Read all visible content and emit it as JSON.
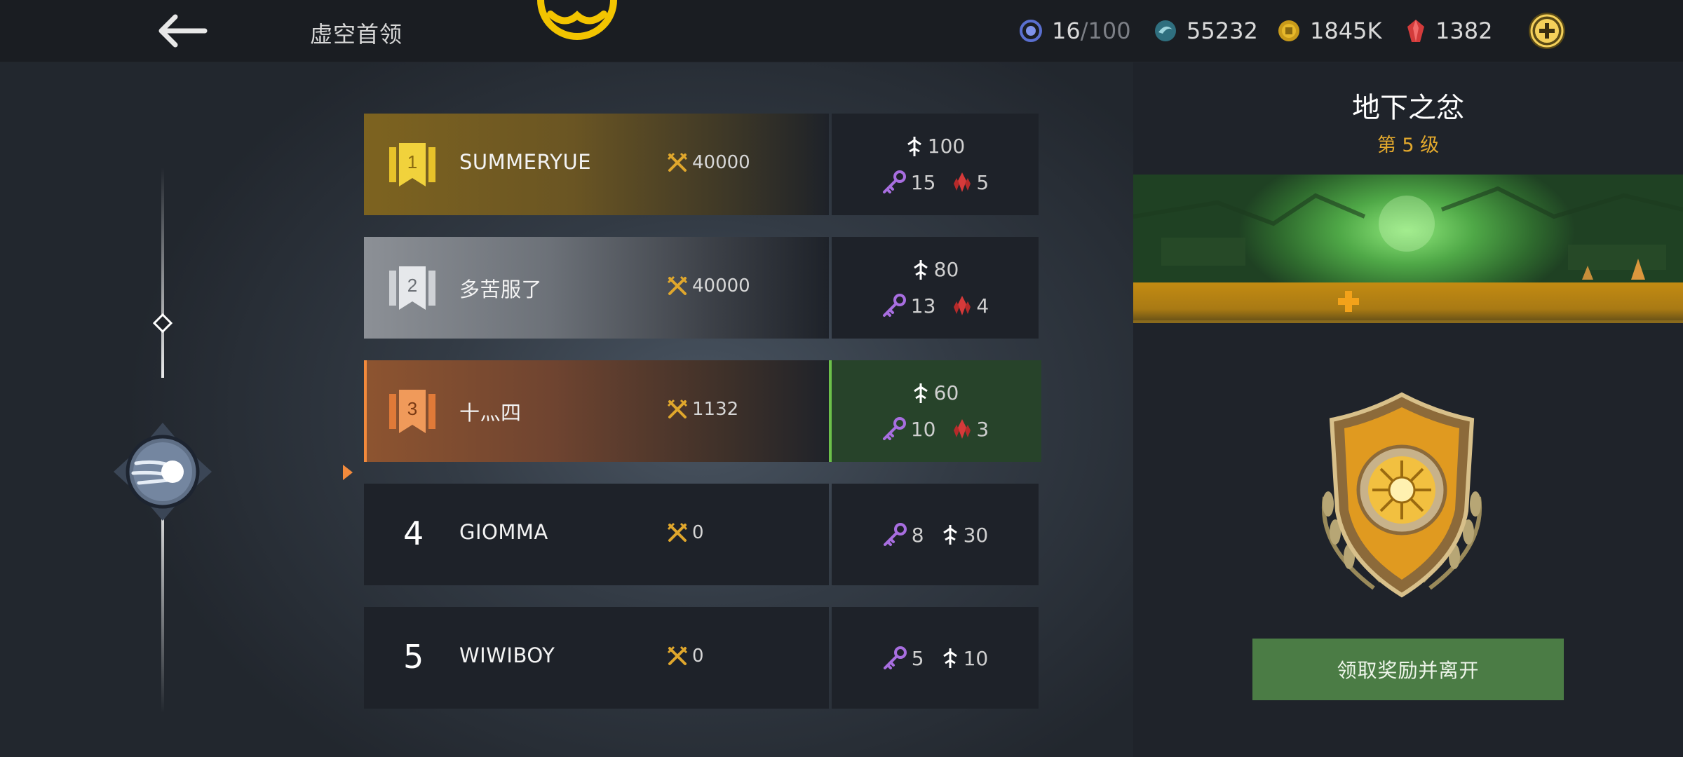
{
  "header": {
    "title": "虚空首领",
    "resources": {
      "energy_current": "16",
      "energy_separator": " / ",
      "energy_max": "100",
      "orbs": "55232",
      "coins": "1845K",
      "gems": "1382"
    }
  },
  "leaderboard": {
    "current_rank": 3,
    "rows": [
      {
        "rank": "1",
        "name": "SUMMERYUE",
        "score": "40000",
        "reward_top": "100",
        "reward_keys": "15",
        "reward_gems": "5"
      },
      {
        "rank": "2",
        "name": "多苦服了",
        "score": "40000",
        "reward_top": "80",
        "reward_keys": "13",
        "reward_gems": "4"
      },
      {
        "rank": "3",
        "name": "十灬四",
        "score": "1132",
        "reward_top": "60",
        "reward_keys": "10",
        "reward_gems": "3"
      },
      {
        "rank": "4",
        "name": "GIOMMA",
        "score": "0",
        "reward_keys": "8",
        "reward_swords": "30"
      },
      {
        "rank": "5",
        "name": "WIWIBOY",
        "score": "0",
        "reward_keys": "5",
        "reward_swords": "10"
      }
    ]
  },
  "boss": {
    "name": "地下之忿",
    "level": "第 5 级",
    "claim_button": "领取奖励并离开"
  },
  "colors": {
    "accent_gold": "#e3a92d",
    "current_row_orange": "#f28a3c",
    "current_reward_green": "#27432a",
    "claim_button_green": "#4b7c45"
  },
  "icons": [
    "back-arrow-icon",
    "emblem-icon",
    "energy-icon",
    "orb-icon",
    "coin-icon",
    "gem-icon",
    "add-icon",
    "crossed-swords-icon",
    "sword-icon",
    "key-icon",
    "crystal-icon",
    "rank-banner-icon",
    "comet-icon",
    "shield-icon"
  ]
}
